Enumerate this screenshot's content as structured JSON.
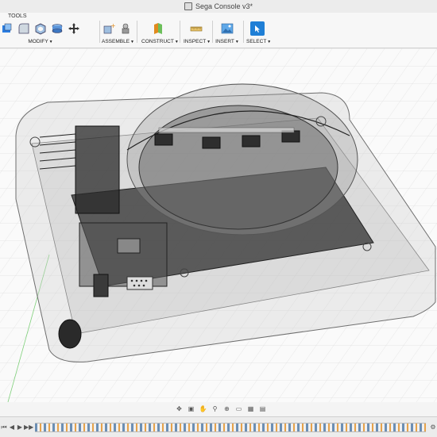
{
  "window": {
    "title": "Sega Console v3*"
  },
  "toolbar": {
    "tools_label": "TOOLS",
    "groups": [
      {
        "label": "MODIFY"
      },
      {
        "label": "ASSEMBLE"
      },
      {
        "label": "CONSTRUCT"
      },
      {
        "label": "INSPECT"
      },
      {
        "label": "INSERT"
      },
      {
        "label": "SELECT"
      }
    ]
  },
  "colors": {
    "accent": "#1f7fd6",
    "grid": "#d9d9d9",
    "body_dark": "#3a3a3a",
    "translucent_shell": "#cfcfcf"
  },
  "icons": {
    "modify": [
      "push-pull",
      "fillet",
      "shell",
      "combine",
      "move"
    ],
    "assemble": [
      "new-component",
      "joint"
    ],
    "construct": [
      "offset-plane"
    ],
    "inspect": [
      "measure"
    ],
    "insert": [
      "insert-image"
    ],
    "select": [
      "select-arrow"
    ]
  }
}
